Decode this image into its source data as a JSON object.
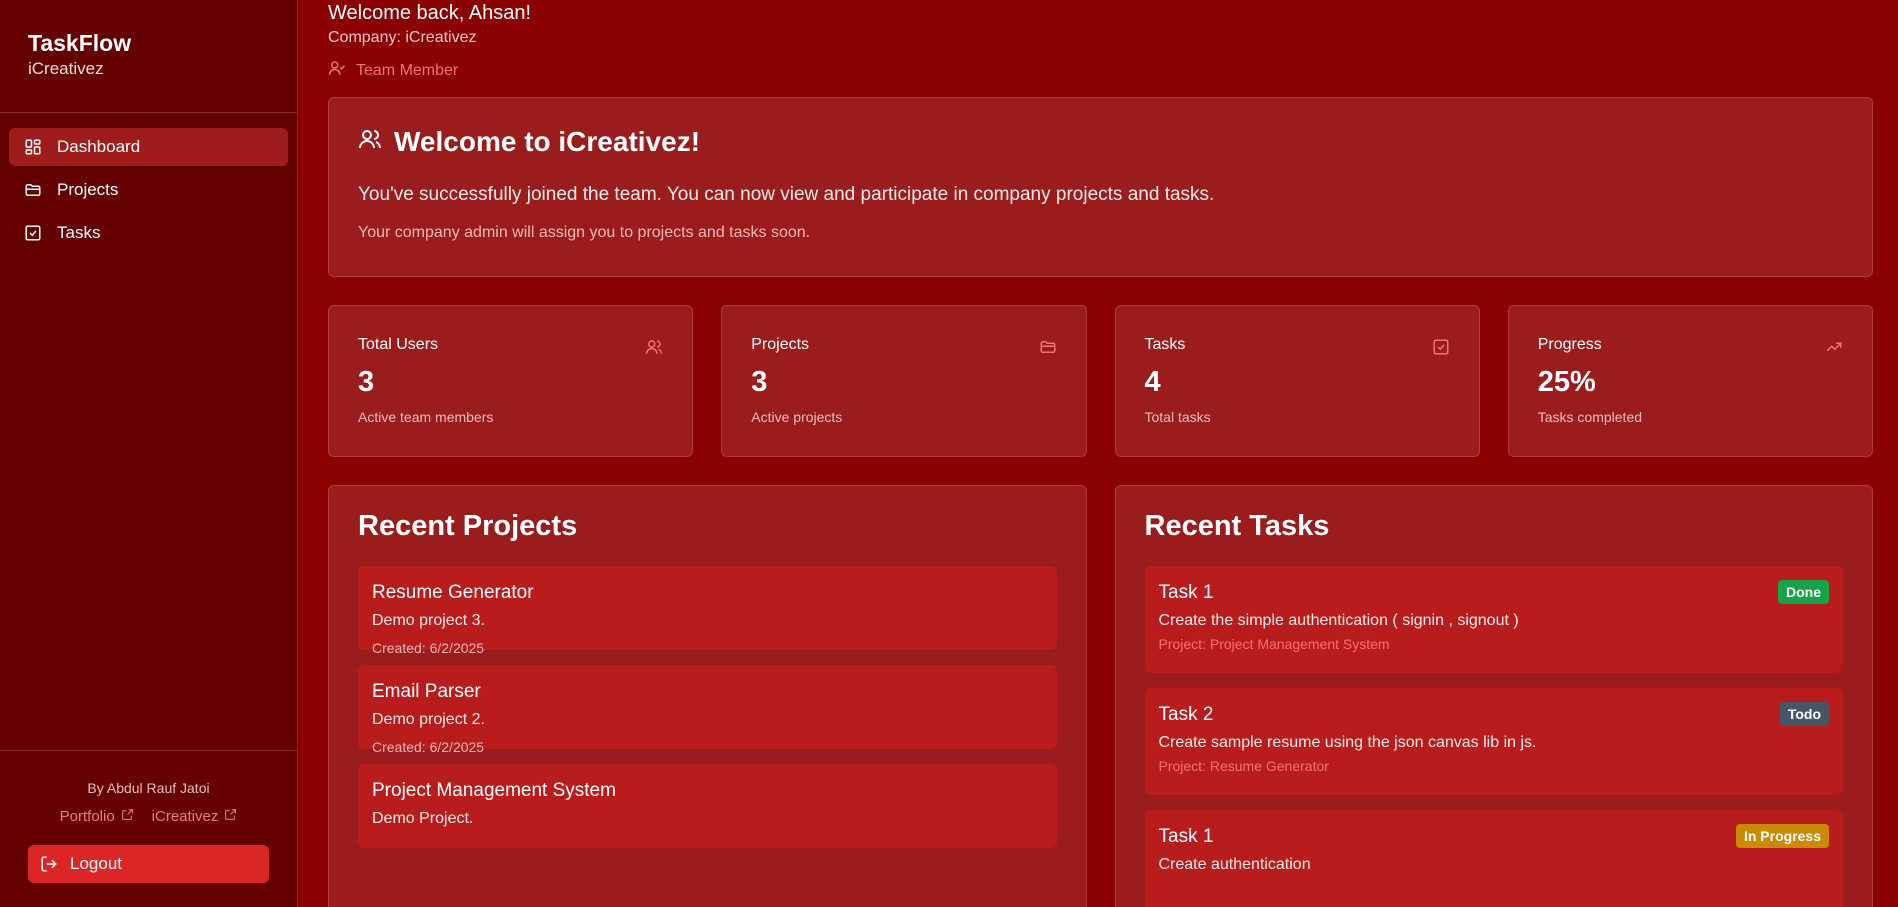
{
  "sidebar": {
    "app_name": "TaskFlow",
    "company": "iCreativez",
    "nav": [
      {
        "label": "Dashboard",
        "icon": "dashboard-icon",
        "active": true
      },
      {
        "label": "Projects",
        "icon": "folder-icon",
        "active": false
      },
      {
        "label": "Tasks",
        "icon": "checkbox-icon",
        "active": false
      }
    ],
    "byline": "By Abdul Rauf Jatoi",
    "links": {
      "portfolio": "Portfolio",
      "company": "iCreativez"
    },
    "logout_label": "Logout"
  },
  "header": {
    "greeting": "Welcome back, Ahsan!",
    "company_line": "Company: iCreativez",
    "role": "Team Member"
  },
  "welcome_card": {
    "title": "Welcome to iCreativez!",
    "message": "You've successfully joined the team. You can now view and participate in company projects and tasks.",
    "note": "Your company admin will assign you to projects and tasks soon."
  },
  "stats": [
    {
      "label": "Total Users",
      "value": "3",
      "sub": "Active team members",
      "icon": "users-icon"
    },
    {
      "label": "Projects",
      "value": "3",
      "sub": "Active projects",
      "icon": "folder-icon"
    },
    {
      "label": "Tasks",
      "value": "4",
      "sub": "Total tasks",
      "icon": "checkbox-icon"
    },
    {
      "label": "Progress",
      "value": "25%",
      "sub": "Tasks completed",
      "icon": "trending-up-icon"
    }
  ],
  "recent_projects": {
    "title": "Recent Projects",
    "items": [
      {
        "name": "Resume Generator",
        "desc": "Demo project 3.",
        "created": "Created: 6/2/2025"
      },
      {
        "name": "Email Parser",
        "desc": "Demo project 2.",
        "created": "Created: 6/2/2025"
      },
      {
        "name": "Project Management System",
        "desc": "Demo Project.",
        "created": ""
      }
    ]
  },
  "recent_tasks": {
    "title": "Recent Tasks",
    "items": [
      {
        "name": "Task 1",
        "desc": "Create the simple authentication ( signin , signout )",
        "project": "Project: Project Management System",
        "status": "Done",
        "status_color": "#16a34a"
      },
      {
        "name": "Task 2",
        "desc": "Create sample resume using the json canvas lib in js.",
        "project": "Project: Resume Generator",
        "status": "Todo",
        "status_color": "#475569"
      },
      {
        "name": "Task 1",
        "desc": "Create authentication",
        "project": "",
        "status": "In Progress",
        "status_color": "#ca8a04"
      }
    ]
  },
  "colors": {
    "background": "#8b0000",
    "sidebar": "#650000",
    "card": "#9b1c1c",
    "item": "#b91c1c",
    "accent": "#f87171",
    "logout": "#dc2626"
  }
}
